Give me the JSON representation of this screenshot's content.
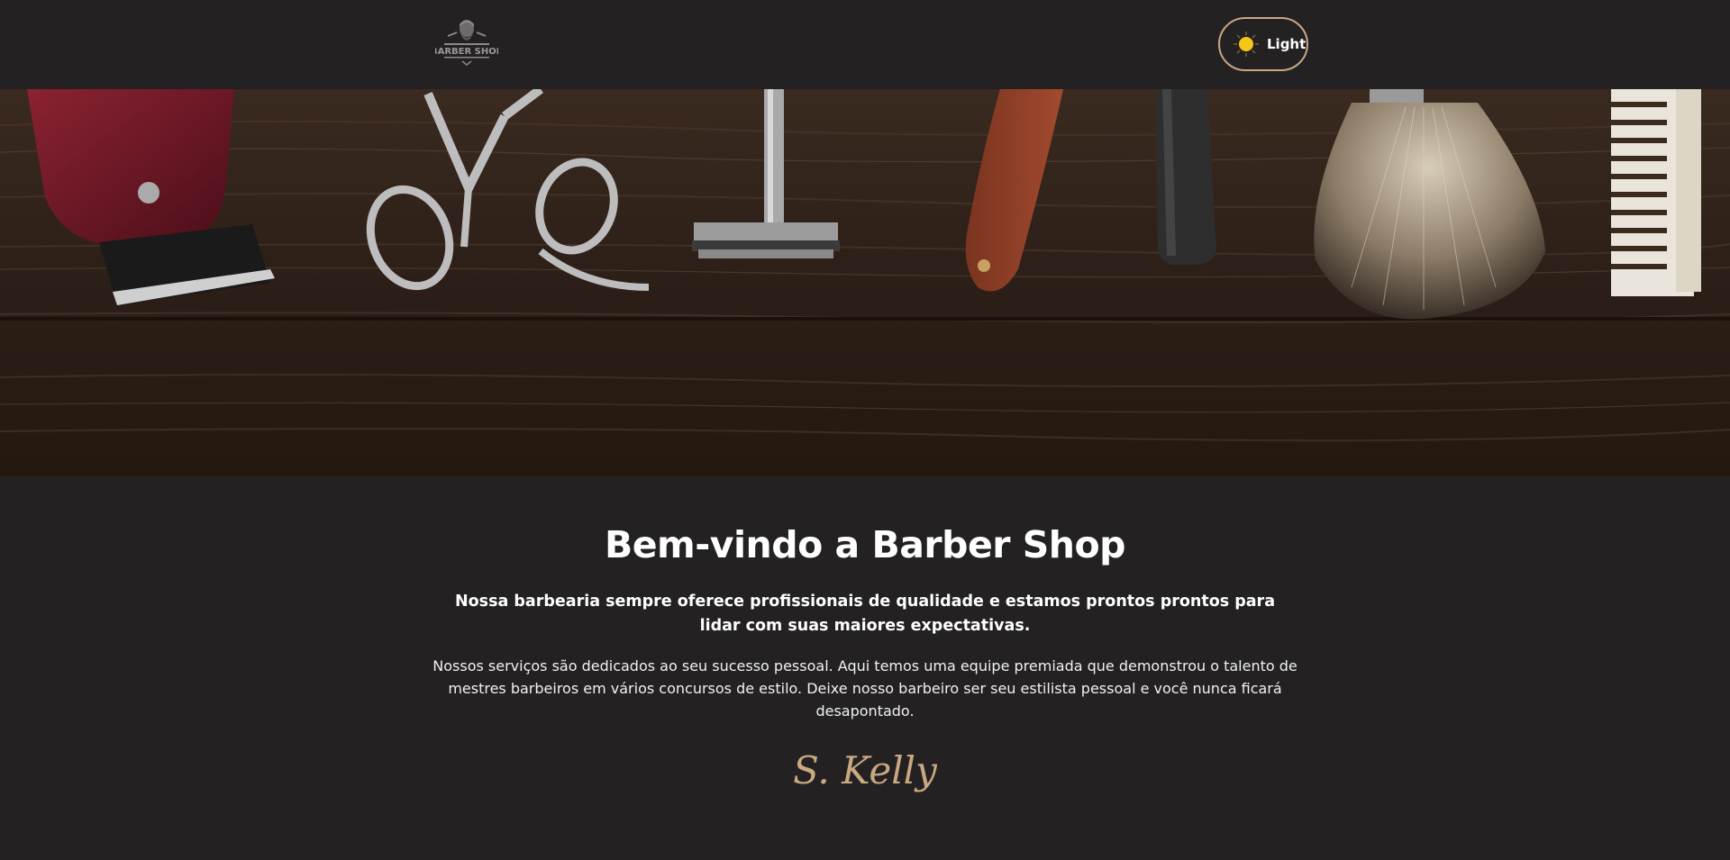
{
  "header": {
    "logo_text": "BARBER SHOP",
    "theme_toggle_label": "Light",
    "icons": {
      "logo": "barber-logo-icon",
      "toggle": "sun-icon"
    }
  },
  "hero": {
    "image": "barber-tools-on-wood",
    "items": [
      "hair-clipper",
      "scissors",
      "safety-razor",
      "straight-razor",
      "comb-handle",
      "shaving-brush",
      "comb"
    ]
  },
  "main": {
    "title": "Bem-vindo a Barber Shop",
    "lead": "Nossa barbearia sempre oferece profissionais de qualidade e estamos prontos prontos para lidar com suas maiores expectativas.",
    "body": "Nossos serviços são dedicados ao seu sucesso pessoal. Aqui temos uma equipe premiada que demonstrou o talento de mestres barbeiros em vários concursos de estilo. Deixe nosso barbeiro ser seu estilista pessoal e você nunca ficará desapontado.",
    "signature": "S. Kelly"
  },
  "colors": {
    "background": "#232122",
    "accent": "#c9a882",
    "text": "#ffffff",
    "sun": "#f5c518"
  }
}
